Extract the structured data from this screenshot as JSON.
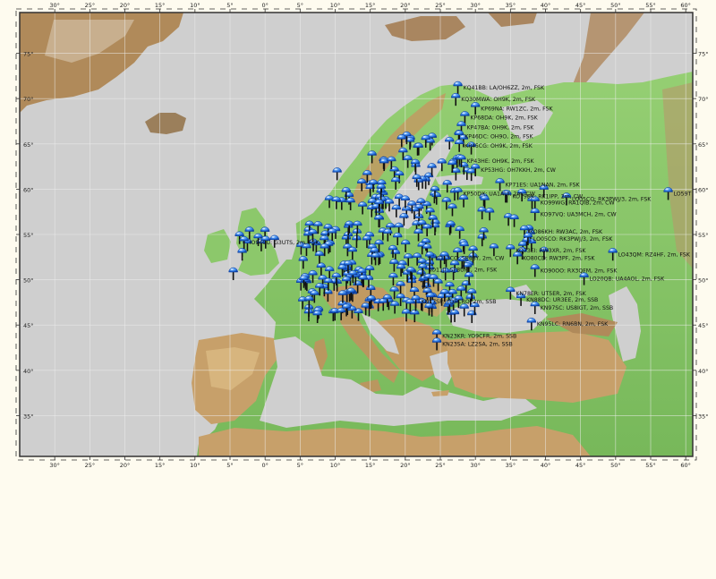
{
  "map": {
    "lon_min": -35,
    "lon_max": 61,
    "lat_min": 30.5,
    "lat_max": 79.5,
    "lon_ticks": [
      "30°",
      "25°",
      "20°",
      "15°",
      "10°",
      "5°",
      "0°",
      "5°",
      "10°",
      "15°",
      "20°",
      "25°",
      "30°",
      "35°",
      "40°",
      "45°",
      "50°",
      "55°",
      "60°"
    ],
    "lat_ticks": [
      "75°",
      "70°",
      "65°",
      "60°",
      "55°",
      "50°",
      "45°",
      "40°",
      "35°"
    ],
    "colors": {
      "page_bg": "#fefbef",
      "sea": "#cfcfcf",
      "grid": "#eeeeee",
      "lowland": "#86c467",
      "highland": "#c19a62",
      "pin_head": "#2e7ae6",
      "pin_stem": "#111111"
    }
  },
  "stations": [
    {
      "label": "KQ41BB: LA/OH6ZZ, 2m, FSK",
      "lon": 27.5,
      "lat": 71.3,
      "side": "right"
    },
    {
      "label": "KQ30MWA: OH9K, 2m, FSK",
      "lon": 27.2,
      "lat": 70.0,
      "side": "right"
    },
    {
      "label": "KP69NA: RW1ZC, 2m, FSK",
      "lon": 30.0,
      "lat": 69.0,
      "side": "right"
    },
    {
      "label": "KP68DA: OH9K, 2m, FSK",
      "lon": 28.5,
      "lat": 68.0,
      "side": "right"
    },
    {
      "label": "KP47BA: OH9K, 2m, FSK",
      "lon": 28.0,
      "lat": 66.9,
      "side": "right"
    },
    {
      "label": "KP46DC: OH9O, 2m, FSK",
      "lon": 27.7,
      "lat": 65.9,
      "side": "right"
    },
    {
      "label": "KP45CG: OH9K, 2m, FSK",
      "lon": 27.7,
      "lat": 64.9,
      "side": "right"
    },
    {
      "label": "KP43HE: OH9K, 2m, FSK",
      "lon": 28.0,
      "lat": 63.2,
      "side": "right"
    },
    {
      "label": "KP53HG: OH7KKH, 2m, CW",
      "lon": 30.0,
      "lat": 62.2,
      "side": "right"
    },
    {
      "label": "KP71ES: UA1NAN, 2m, FSK",
      "lon": 33.5,
      "lat": 60.6,
      "side": "right"
    },
    {
      "label": "KP50DX: UA1AUI, 2m, CW",
      "lon": 27.5,
      "lat": 59.6,
      "side": "right"
    },
    {
      "label": "KO79BK: RK1IPP, 2m, CW",
      "lon": 34.5,
      "lat": 59.3,
      "side": "right"
    },
    {
      "label": "KO99WG: RA1QIB, 2m, CW",
      "lon": 38.5,
      "lat": 58.6,
      "side": "right"
    },
    {
      "label": "LO05CO: RK3PWJ/3, 2m, FSK",
      "lon": 43.0,
      "lat": 59.0,
      "side": "right"
    },
    {
      "label": "KO97VQ: UA3MCH, 2m, CW",
      "lon": 38.5,
      "lat": 57.3,
      "side": "right"
    },
    {
      "label": "KO86KH: RW3AC, 2m, FSK",
      "lon": 37.0,
      "lat": 55.4,
      "side": "right"
    },
    {
      "label": "LO05CO: RK3PWJ/3, 2m, FSK",
      "lon": 37.5,
      "lat": 54.6,
      "side": "right"
    },
    {
      "label": "IO94CU: G3UTS, 2m, FSK",
      "lon": -3.0,
      "lat": 54.2,
      "side": "right"
    },
    {
      "label": "LO43QM: RZ4HF, 2m, FSK",
      "lon": 49.6,
      "lat": 52.9,
      "side": "right"
    },
    {
      "label": "KO73EI: RW3XR, 2m, FSK",
      "lon": 35.0,
      "lat": 53.3,
      "side": "right"
    },
    {
      "label": "KO13CO: SP4BY, 2m, CW",
      "lon": 23.5,
      "lat": 52.5,
      "side": "right"
    },
    {
      "label": "KO80CD: RW3PF, 2m, FSK",
      "lon": 36.0,
      "lat": 52.5,
      "side": "right"
    },
    {
      "label": "KO11JI: SP8UFT, 2m, FSK",
      "lon": 22.5,
      "lat": 51.2,
      "side": "right"
    },
    {
      "label": "KO90OO: RX3QFM, 2m, FSK",
      "lon": 38.5,
      "lat": 51.1,
      "side": "right"
    },
    {
      "label": "LO20QB: UA4AOL, 2m, FSK",
      "lon": 45.5,
      "lat": 50.2,
      "side": "right"
    },
    {
      "label": "KN78ER: UT5ER, 2m, FSK",
      "lon": 35.0,
      "lat": 48.6,
      "side": "right"
    },
    {
      "label": "KN88DC: UR3EE, 2m, SSB",
      "lon": 36.5,
      "lat": 47.9,
      "side": "right"
    },
    {
      "label": "KN17SP: YO5CRQ, 2m, SSB",
      "lon": 21.5,
      "lat": 47.7,
      "side": "right"
    },
    {
      "label": "KN97SC: US8IGT, 2m, SSB",
      "lon": 38.5,
      "lat": 47.0,
      "side": "right"
    },
    {
      "label": "KN95LC: RN6BN, 2m, FSK",
      "lon": 38.0,
      "lat": 45.2,
      "side": "right"
    },
    {
      "label": "KN23KR: YO9CFR, 2m, SSB",
      "lon": 24.5,
      "lat": 43.9,
      "side": "right"
    },
    {
      "label": "KN23SA: LZ2SA, 2m, SSB",
      "lon": 24.5,
      "lat": 43.0,
      "side": "right"
    },
    {
      "label": "LO59T",
      "lon": 57.5,
      "lat": 59.6,
      "side": "right"
    }
  ]
}
